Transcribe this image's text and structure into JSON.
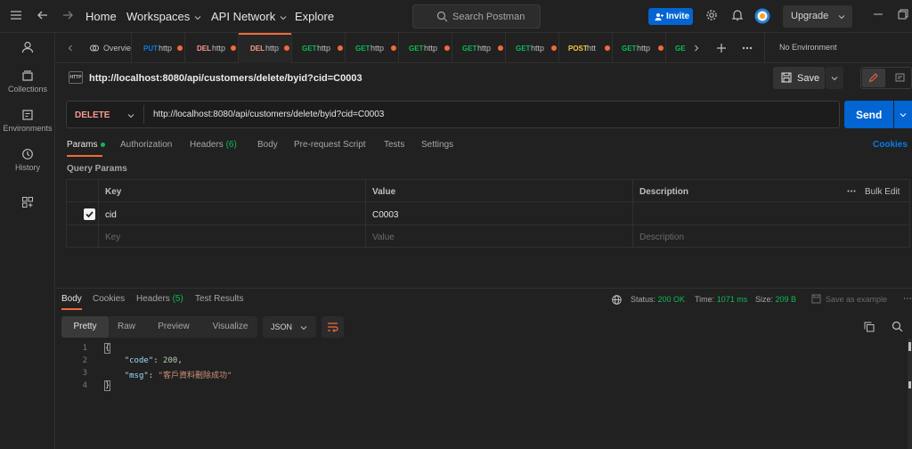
{
  "topbar": {
    "home": "Home",
    "workspaces": "Workspaces",
    "api_network": "API Network",
    "explore": "Explore",
    "search_placeholder": "Search Postman",
    "invite": "Invite",
    "upgrade": "Upgrade"
  },
  "sidebar": {
    "items": [
      {
        "label": "",
        "icon": "user-icon"
      },
      {
        "label": "Collections",
        "icon": "collections-icon"
      },
      {
        "label": "Environments",
        "icon": "environments-icon"
      },
      {
        "label": "History",
        "icon": "history-icon"
      },
      {
        "label": "",
        "icon": "new-grid-icon"
      }
    ]
  },
  "tabs": [
    {
      "method": "",
      "text": "Overvie"
    },
    {
      "method": "PUT",
      "text": "http"
    },
    {
      "method": "DEL",
      "text": "http"
    },
    {
      "method": "DEL",
      "text": "http"
    },
    {
      "method": "GET",
      "text": "http"
    },
    {
      "method": "GET",
      "text": "http"
    },
    {
      "method": "GET",
      "text": "http"
    },
    {
      "method": "GET",
      "text": "http"
    },
    {
      "method": "GET",
      "text": "http"
    },
    {
      "method": "POST",
      "text": "htt"
    },
    {
      "method": "GET",
      "text": "http"
    },
    {
      "method": "GE",
      "text": ""
    }
  ],
  "environment": "No Environment",
  "request": {
    "icon_text": "HTTP",
    "title": "http://localhost:8080/api/customers/delete/byid?cid=C0003",
    "save": "Save",
    "method": "DELETE",
    "url": "http://localhost:8080/api/customers/delete/byid?cid=C0003",
    "send": "Send",
    "tabs": [
      "Params",
      "Authorization",
      "Headers",
      "Body",
      "Pre-request Script",
      "Tests",
      "Settings"
    ],
    "headers_count": "(6)",
    "cookies": "Cookies",
    "query_params_label": "Query Params",
    "table": {
      "headers": [
        "Key",
        "Value",
        "Description"
      ],
      "bulk_edit": "Bulk Edit",
      "rows": [
        {
          "key": "cid",
          "value": "C0003",
          "description": "",
          "checked": true
        }
      ],
      "placeholder": {
        "key": "Key",
        "value": "Value",
        "description": "Description"
      }
    }
  },
  "response": {
    "tabs": [
      "Body",
      "Cookies",
      "Headers",
      "Test Results"
    ],
    "headers_count": "(5)",
    "status_label": "Status:",
    "status": "200 OK",
    "time_label": "Time:",
    "time": "1071 ms",
    "size_label": "Size:",
    "size": "209 B",
    "save_example": "Save as example",
    "view_tabs": [
      "Pretty",
      "Raw",
      "Preview",
      "Visualize"
    ],
    "format": "JSON",
    "line_numbers": [
      "1",
      "2",
      "3",
      "4"
    ],
    "code": {
      "open": "{",
      "code_key": "\"code\"",
      "code_val": "200",
      "msg_key": "\"msg\"",
      "msg_val": "\"客戶資料刪除成功\"",
      "close": "}"
    }
  }
}
